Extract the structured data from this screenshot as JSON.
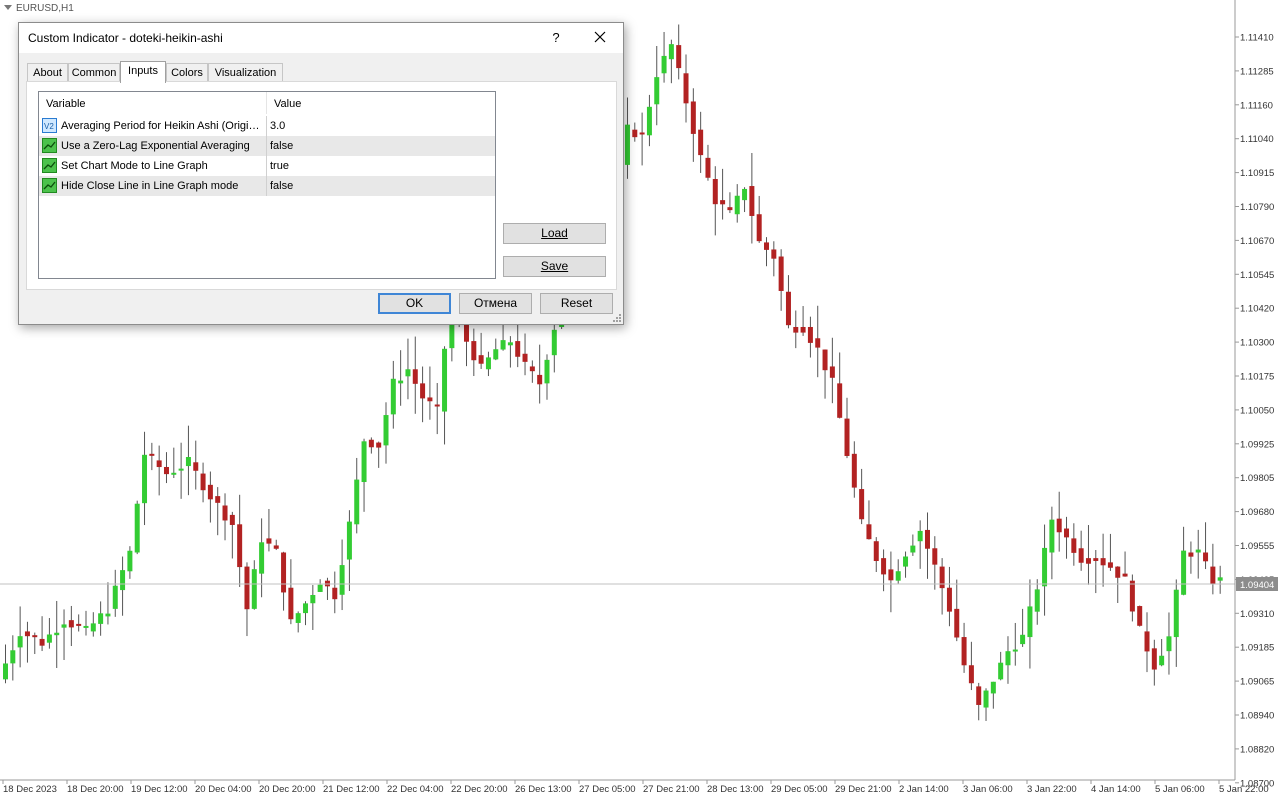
{
  "chart": {
    "symbol_title": "EURUSD,H1",
    "price_labels": [
      "1.11410",
      "1.11285",
      "1.11160",
      "1.11040",
      "1.10915",
      "1.10790",
      "1.10670",
      "1.10545",
      "1.10420",
      "1.10300",
      "1.10175",
      "1.10050",
      "1.09925",
      "1.09805",
      "1.09680",
      "1.09555",
      "1.09435",
      "1.09310",
      "1.09185",
      "1.09065",
      "1.08940",
      "1.08820",
      "1.08700"
    ],
    "current_price": "1.09404",
    "time_labels": [
      "18 Dec 2023",
      "18 Dec 20:00",
      "19 Dec 12:00",
      "20 Dec 04:00",
      "20 Dec 20:00",
      "21 Dec 12:00",
      "22 Dec 04:00",
      "22 Dec 20:00",
      "26 Dec 13:00",
      "27 Dec 05:00",
      "27 Dec 21:00",
      "28 Dec 13:00",
      "29 Dec 05:00",
      "29 Dec 21:00",
      "2 Jan 14:00",
      "3 Jan 06:00",
      "3 Jan 22:00",
      "4 Jan 14:00",
      "5 Jan 06:00",
      "5 Jan 22:00"
    ],
    "colors": {
      "bull": "#33cc33",
      "bear": "#b22222",
      "wick": "#555555",
      "grid": "#c8c8c8",
      "current_line": "#c0c0c0",
      "price_tag": "#8c8c8c"
    }
  },
  "chart_data": {
    "type": "candlestick",
    "title": "EURUSD,H1",
    "ylim": [
      1.087,
      1.1146
    ],
    "path": [
      [
        0,
        1.0905
      ],
      [
        3,
        1.0922
      ],
      [
        6,
        1.0918
      ],
      [
        9,
        1.0926
      ],
      [
        12,
        1.0922
      ],
      [
        15,
        1.093
      ],
      [
        18,
        1.095
      ],
      [
        20,
        1.0985
      ],
      [
        23,
        1.0978
      ],
      [
        26,
        1.0982
      ],
      [
        29,
        1.097
      ],
      [
        32,
        1.096
      ],
      [
        34,
        1.093
      ],
      [
        36,
        1.0955
      ],
      [
        38,
        1.095
      ],
      [
        40,
        1.0925
      ],
      [
        42,
        1.0932
      ],
      [
        44,
        1.094
      ],
      [
        46,
        1.0935
      ],
      [
        48,
        1.096
      ],
      [
        50,
        1.099
      ],
      [
        52,
        1.0988
      ],
      [
        54,
        1.101
      ],
      [
        56,
        1.1015
      ],
      [
        58,
        1.1005
      ],
      [
        60,
        1.1
      ],
      [
        62,
        1.1045
      ],
      [
        64,
        1.1025
      ],
      [
        66,
        1.1015
      ],
      [
        68,
        1.1022
      ],
      [
        70,
        1.1025
      ],
      [
        72,
        1.1016
      ],
      [
        74,
        1.101
      ],
      [
        76,
        1.103
      ],
      [
        78,
        1.1055
      ],
      [
        80,
        1.105
      ],
      [
        82,
        1.1042
      ],
      [
        84,
        1.1075
      ],
      [
        86,
        1.11
      ],
      [
        88,
        1.1098
      ],
      [
        90,
        1.112
      ],
      [
        92,
        1.113
      ],
      [
        94,
        1.111
      ],
      [
        96,
        1.109
      ],
      [
        98,
        1.1075
      ],
      [
        100,
        1.107
      ],
      [
        102,
        1.108
      ],
      [
        104,
        1.106
      ],
      [
        106,
        1.1055
      ],
      [
        108,
        1.103
      ],
      [
        110,
        1.103
      ],
      [
        112,
        1.1022
      ],
      [
        114,
        1.101
      ],
      [
        116,
        1.0985
      ],
      [
        118,
        1.096
      ],
      [
        120,
        1.0948
      ],
      [
        122,
        1.094
      ],
      [
        124,
        1.095
      ],
      [
        126,
        1.0958
      ],
      [
        128,
        1.0945
      ],
      [
        130,
        1.093
      ],
      [
        132,
        1.091
      ],
      [
        134,
        1.0895
      ],
      [
        136,
        1.0905
      ],
      [
        138,
        1.0915
      ],
      [
        140,
        1.092
      ],
      [
        142,
        1.0938
      ],
      [
        144,
        1.0962
      ],
      [
        146,
        1.0955
      ],
      [
        148,
        1.0948
      ],
      [
        150,
        1.0948
      ],
      [
        152,
        1.0945
      ],
      [
        154,
        1.094
      ],
      [
        156,
        1.0922
      ],
      [
        158,
        1.091
      ],
      [
        160,
        1.092
      ],
      [
        162,
        1.095
      ],
      [
        164,
        1.095
      ],
      [
        166,
        1.094
      ]
    ]
  },
  "dialog": {
    "title": "Custom Indicator - doteki-heikin-ashi",
    "help": "?",
    "tabs": [
      "About",
      "Common",
      "Inputs",
      "Colors",
      "Visualization"
    ],
    "active_tab": "Inputs",
    "columns": {
      "variable": "Variable",
      "value": "Value"
    },
    "inputs": [
      {
        "icon": "number-icon",
        "variable": "Averaging Period for Heikin Ashi (Origina...",
        "value": "3.0"
      },
      {
        "icon": "bool-icon",
        "variable": "Use a Zero-Lag Exponential Averaging",
        "value": "false"
      },
      {
        "icon": "bool-icon",
        "variable": "Set Chart Mode to Line Graph",
        "value": "true"
      },
      {
        "icon": "bool-icon",
        "variable": "Hide Close Line in Line Graph mode",
        "value": "false"
      }
    ],
    "buttons": {
      "load": "Load",
      "save": "Save",
      "ok": "OK",
      "cancel": "Отмена",
      "reset": "Reset"
    }
  }
}
